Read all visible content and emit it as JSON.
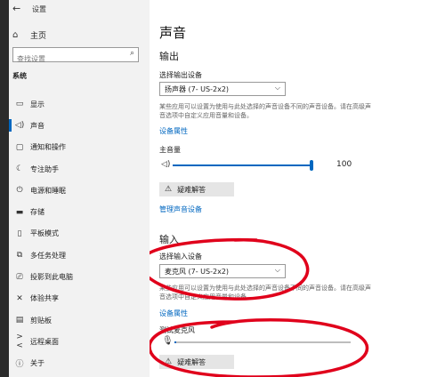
{
  "window": {
    "title": "设置"
  },
  "sidebar": {
    "home_label": "主页",
    "search_placeholder": "查找设置",
    "section_label": "系统",
    "items": [
      {
        "label": "显示",
        "icon": "display-icon"
      },
      {
        "label": "声音",
        "icon": "speaker-icon",
        "active": true
      },
      {
        "label": "通知和操作",
        "icon": "notification-icon"
      },
      {
        "label": "专注助手",
        "icon": "moon-icon"
      },
      {
        "label": "电源和睡眠",
        "icon": "power-icon"
      },
      {
        "label": "存储",
        "icon": "storage-icon"
      },
      {
        "label": "平板模式",
        "icon": "tablet-icon"
      },
      {
        "label": "多任务处理",
        "icon": "multitask-icon"
      },
      {
        "label": "投影到此电脑",
        "icon": "project-icon"
      },
      {
        "label": "体验共享",
        "icon": "share-icon"
      },
      {
        "label": "剪贴板",
        "icon": "clipboard-icon"
      },
      {
        "label": "远程桌面",
        "icon": "remote-desktop-icon"
      },
      {
        "label": "关于",
        "icon": "info-icon"
      }
    ]
  },
  "main": {
    "title": "声音",
    "output": {
      "heading": "输出",
      "device_label": "选择输出设备",
      "device_value": "扬声器 (7- US-2x2)",
      "description": "某些应用可以设置为使用与此处选择的声音设备不同的声音设备。请在高级声音选项中自定义应用音量和设备。",
      "properties_link": "设备属性",
      "volume_label": "主音量",
      "volume_value": "100",
      "volume_fraction": 1.0,
      "troubleshoot_label": "疑难解答",
      "manage_link": "管理声音设备"
    },
    "input": {
      "heading": "输入",
      "device_label": "选择输入设备",
      "device_value": "麦克风 (7- US-2x2)",
      "description": "某些应用可以设置为使用与此处选择的声音设备不同的声音设备。请在高级声音选项中自定义应用音量和设备。",
      "properties_link": "设备属性",
      "test_label": "测试麦克风",
      "mic_level_fraction": 0.01,
      "troubleshoot_label": "疑难解答"
    }
  },
  "colors": {
    "accent": "#0067c0",
    "annotation": "#e0001b",
    "sidebar_bg": "#f2f2f2"
  }
}
